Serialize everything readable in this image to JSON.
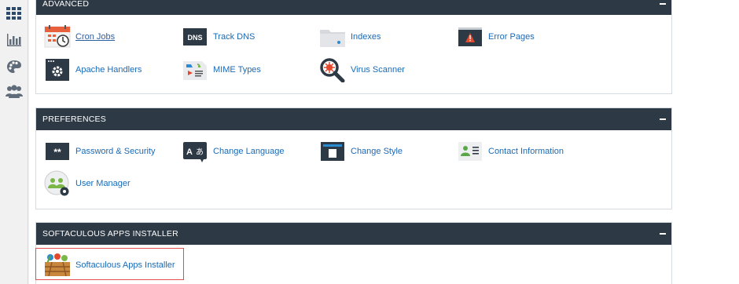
{
  "sidebar": {
    "icons": [
      "grid-icon",
      "bar-chart-icon",
      "palette-icon",
      "users-icon"
    ]
  },
  "panels": {
    "advanced": {
      "title": "ADVANCED",
      "items": [
        {
          "label": "Cron Jobs",
          "icon": "calendar-clock-icon"
        },
        {
          "label": "Track DNS",
          "icon": "dns-icon"
        },
        {
          "label": "Indexes",
          "icon": "folder-icon"
        },
        {
          "label": "Error Pages",
          "icon": "warning-page-icon"
        },
        {
          "label": "Apache Handlers",
          "icon": "gear-window-icon"
        },
        {
          "label": "MIME Types",
          "icon": "mime-icon"
        },
        {
          "label": "Virus Scanner",
          "icon": "virus-magnifier-icon"
        }
      ]
    },
    "preferences": {
      "title": "PREFERENCES",
      "items": [
        {
          "label": "Password & Security",
          "icon": "password-icon"
        },
        {
          "label": "Change Language",
          "icon": "language-icon"
        },
        {
          "label": "Change Style",
          "icon": "style-icon"
        },
        {
          "label": "Contact Information",
          "icon": "contact-card-icon"
        },
        {
          "label": "User Manager",
          "icon": "user-manager-icon"
        }
      ]
    },
    "softaculous": {
      "title": "SOFTACULOUS APPS INSTALLER",
      "items": [
        {
          "label": "Softaculous Apps Installer",
          "icon": "softaculous-box-icon"
        }
      ]
    }
  },
  "colors": {
    "header_bg": "#2d3945",
    "link": "#1a6ab7",
    "highlight": "#e74c4c"
  }
}
